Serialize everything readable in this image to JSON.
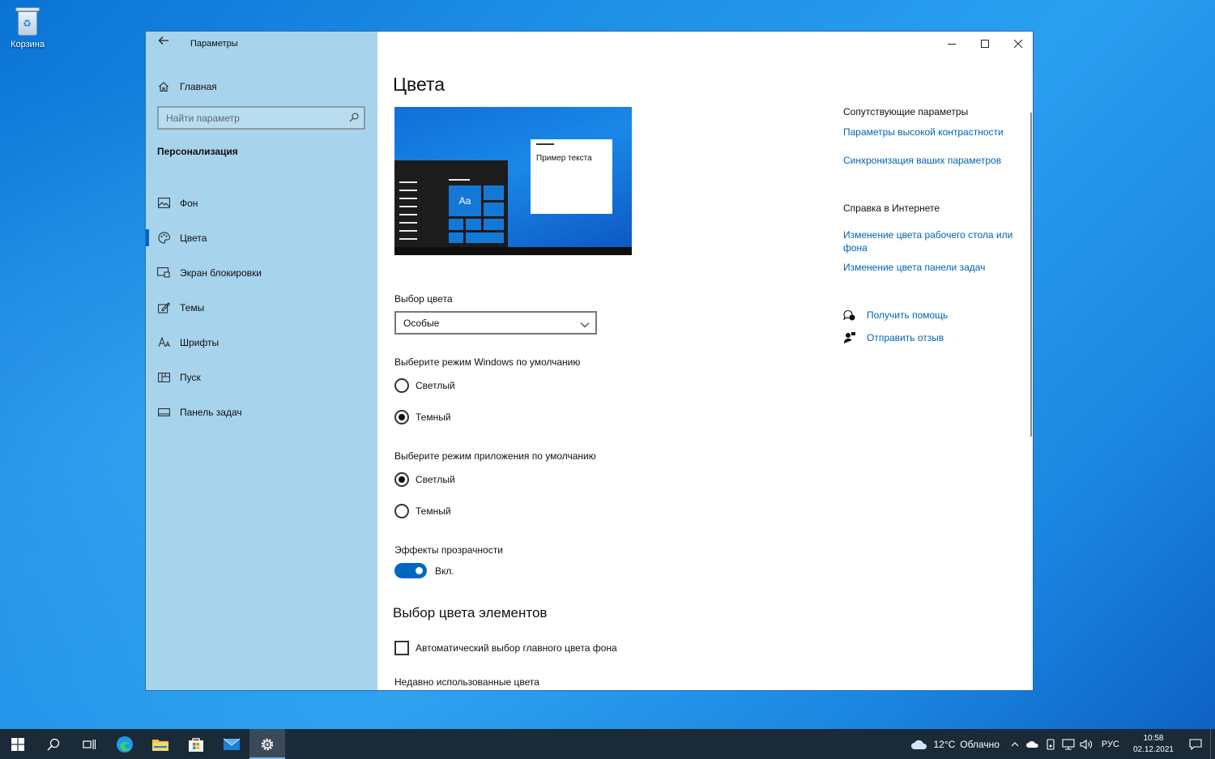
{
  "desktop": {
    "recycle_bin_label": "Корзина"
  },
  "window": {
    "app_title": "Параметры",
    "sidebar": {
      "home_label": "Главная",
      "search_placeholder": "Найти параметр",
      "section_title": "Персонализация",
      "items": [
        {
          "label": "Фон",
          "icon": "image-icon"
        },
        {
          "label": "Цвета",
          "icon": "palette-icon",
          "active": true
        },
        {
          "label": "Экран блокировки",
          "icon": "lock-screen-icon"
        },
        {
          "label": "Темы",
          "icon": "themes-icon"
        },
        {
          "label": "Шрифты",
          "icon": "fonts-icon"
        },
        {
          "label": "Пуск",
          "icon": "start-menu-icon"
        },
        {
          "label": "Панель задач",
          "icon": "taskbar-icon"
        }
      ]
    },
    "main": {
      "page_title": "Цвета",
      "preview": {
        "sample_text": "Пример текста",
        "tile_text": "Aa"
      },
      "color_choice": {
        "label": "Выбор цвета",
        "selected": "Особые"
      },
      "windows_mode": {
        "label": "Выберите режим Windows по умолчанию",
        "options": [
          {
            "label": "Светлый",
            "checked": false
          },
          {
            "label": "Темный",
            "checked": true
          }
        ]
      },
      "app_mode": {
        "label": "Выберите режим приложения по умолчанию",
        "options": [
          {
            "label": "Светлый",
            "checked": true
          },
          {
            "label": "Темный",
            "checked": false
          }
        ]
      },
      "transparency": {
        "label": "Эффекты прозрачности",
        "state": "Вкл.",
        "on": true
      },
      "accent_section_title": "Выбор цвета элементов",
      "auto_accent_label": "Автоматический выбор главного цвета фона",
      "recent_colors_label": "Недавно использованные цвета"
    },
    "related": {
      "heading": "Сопутствующие параметры",
      "links": [
        "Параметры высокой контрастности",
        "Синхронизация ваших параметров"
      ],
      "help_heading": "Справка в Интернете",
      "help_links": [
        "Изменение цвета рабочего стола или фона",
        "Изменение цвета панели задач"
      ],
      "get_help": "Получить помощь",
      "feedback": "Отправить отзыв"
    }
  },
  "taskbar": {
    "weather_temp": "12°C",
    "weather_text": "Облачно",
    "language": "РУС",
    "time": "10:58",
    "date": "02.12.2021"
  },
  "colors": {
    "accent": "#0067c0",
    "link": "#0063b1",
    "sidebar": "#a7d3ec",
    "taskbar": "#1b2a37"
  }
}
